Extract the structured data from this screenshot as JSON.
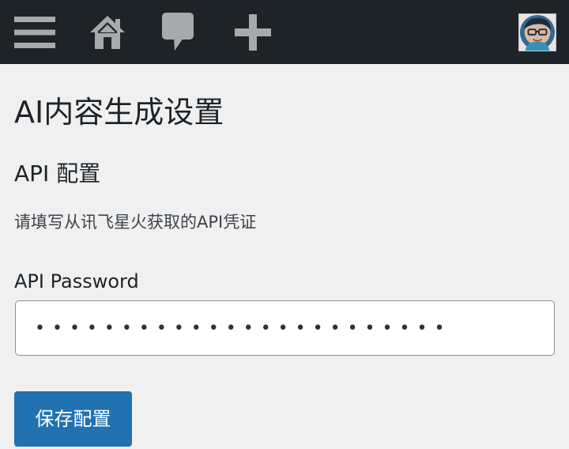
{
  "adminbar": {
    "icons": [
      "menu-icon",
      "home-icon",
      "comments-icon",
      "plus-icon"
    ],
    "icon_color": "#a7aaad",
    "background": "#1d2327"
  },
  "page": {
    "title": "AI内容生成设置"
  },
  "section": {
    "title": "API 配置",
    "description": "请填写从讯飞星火获取的API凭证"
  },
  "fields": {
    "password_label": "API Password",
    "password_value": "••••••••••••••••••••••••"
  },
  "actions": {
    "save_label": "保存配置",
    "accent": "#2271b1"
  }
}
